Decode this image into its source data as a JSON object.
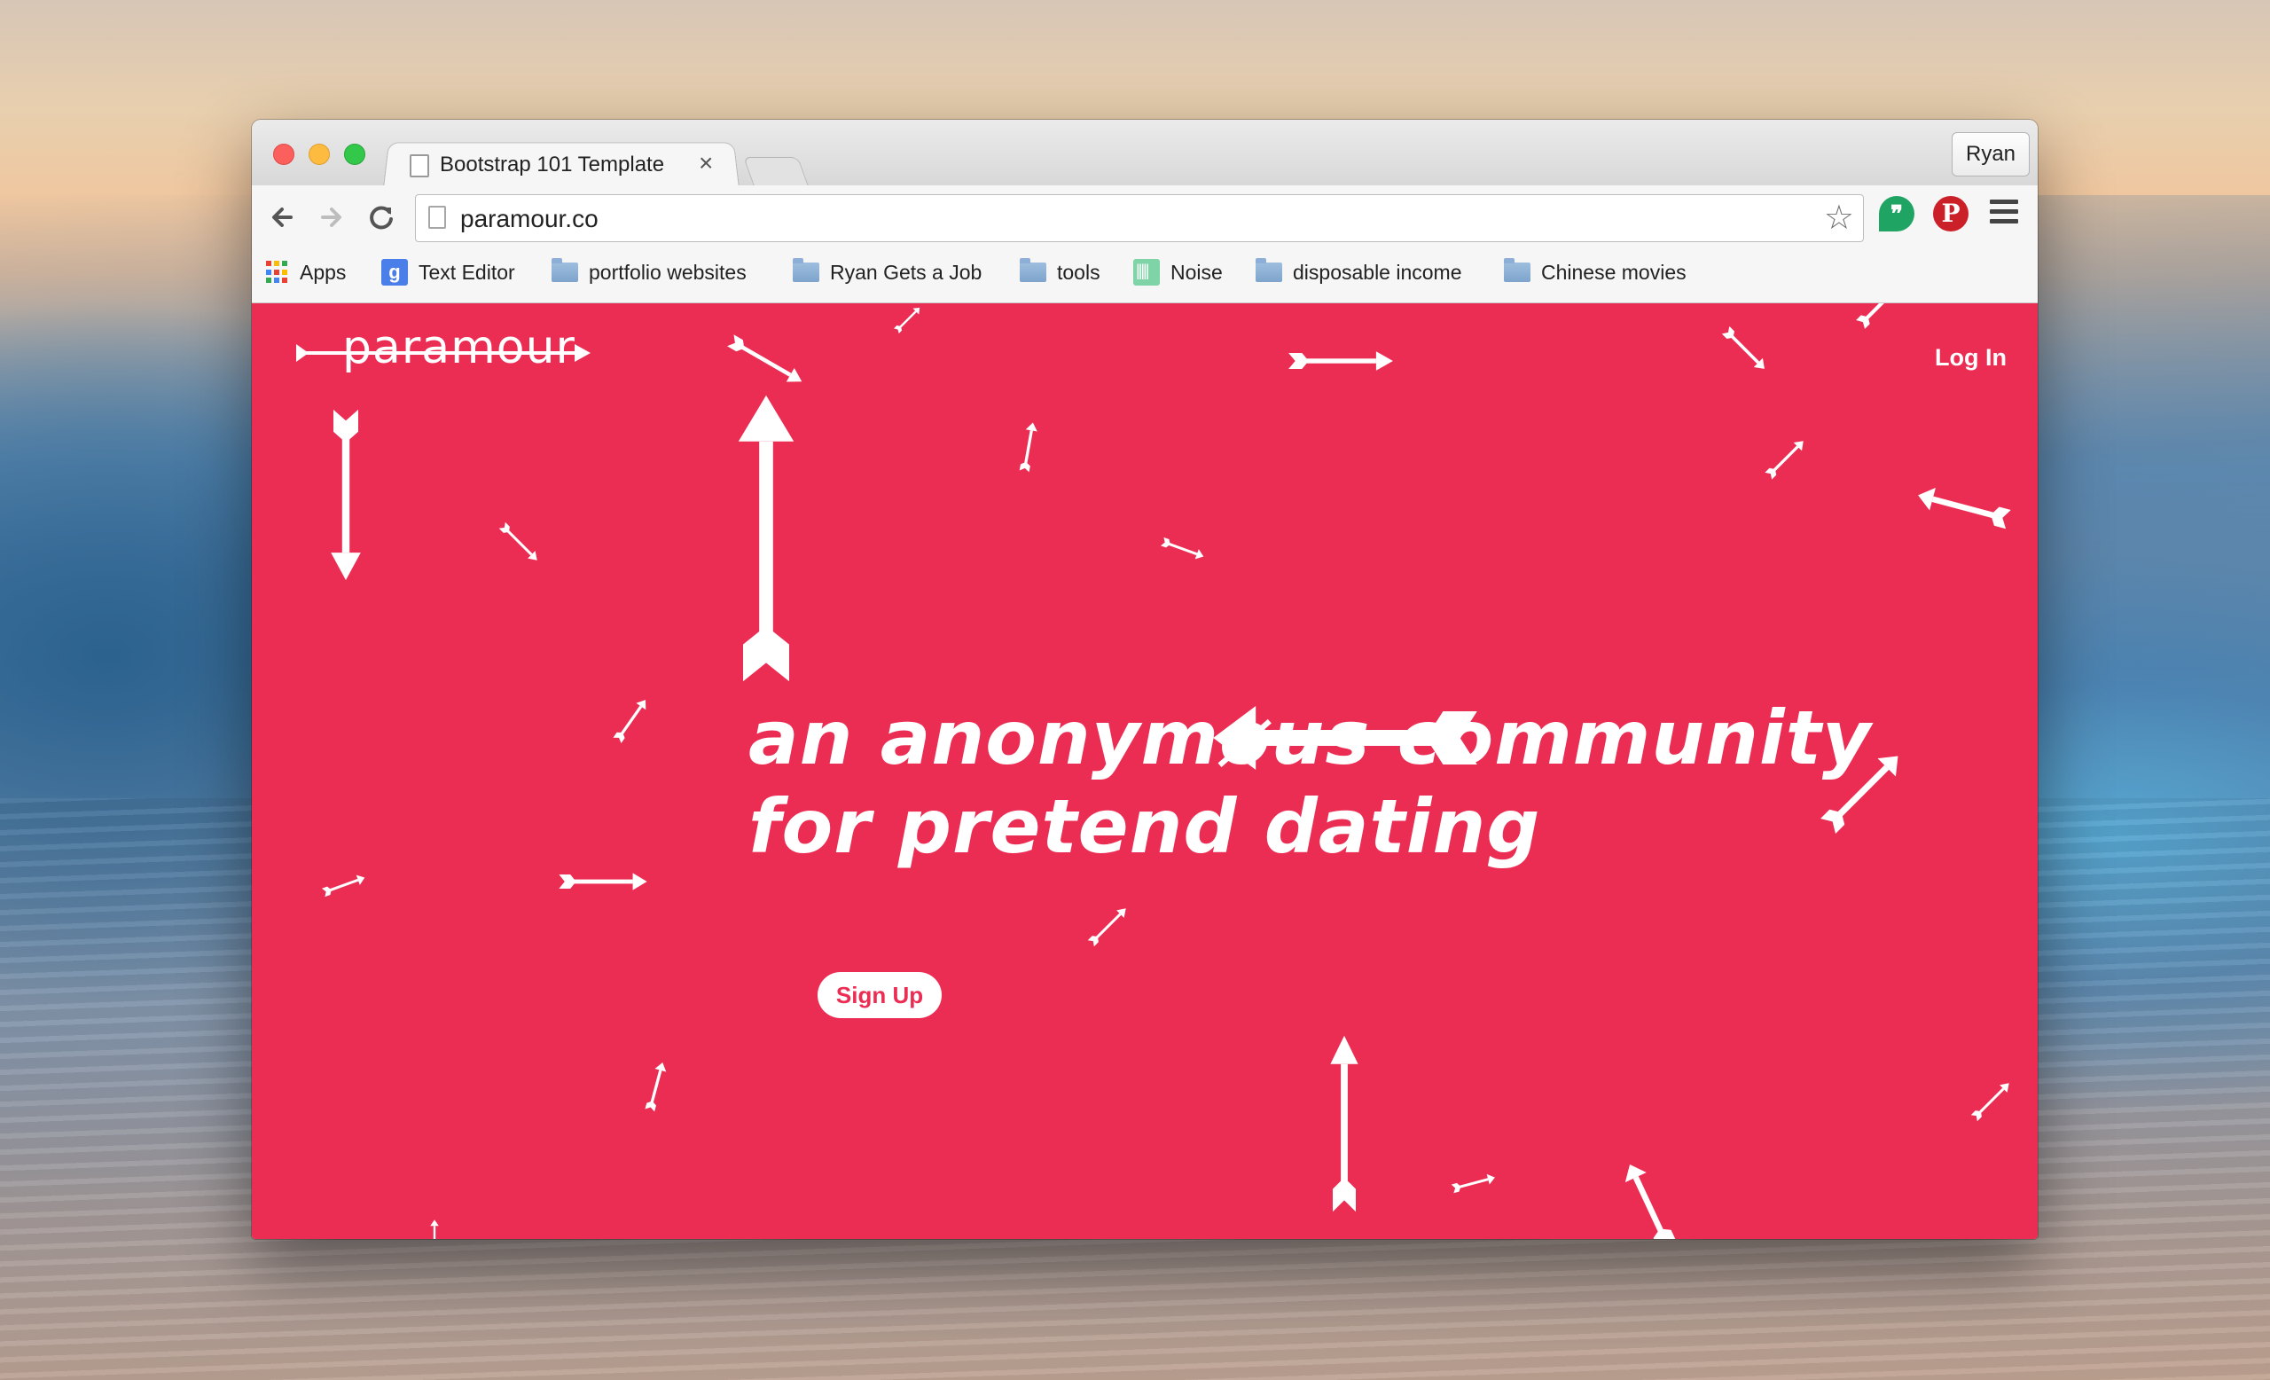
{
  "browser": {
    "tab_title": "Bootstrap 101 Template",
    "tab_close": "×",
    "profile_name": "Ryan",
    "url": "paramour.co",
    "bookmark_star": "☆",
    "ext_pinterest": "P",
    "ext_hangouts": "❞"
  },
  "bookmarks": [
    {
      "label": "Apps",
      "icon": "apps-icon"
    },
    {
      "label": "Text Editor",
      "icon": "google-icon"
    },
    {
      "label": "portfolio websites",
      "icon": "folder-icon"
    },
    {
      "label": "Ryan Gets a Job",
      "icon": "folder-icon"
    },
    {
      "label": "tools",
      "icon": "folder-icon"
    },
    {
      "label": "Noise",
      "icon": "noise-icon"
    },
    {
      "label": "disposable income",
      "icon": "folder-icon"
    },
    {
      "label": "Chinese movies",
      "icon": "folder-icon"
    }
  ],
  "site": {
    "brand": "paramour",
    "login": "Log In",
    "headline_line1": "an anonymøus community",
    "headline_line2": "for pretend dating",
    "signup": "Sign Up",
    "brand_color": "#ec2d53"
  },
  "google_icon_letter": "g"
}
